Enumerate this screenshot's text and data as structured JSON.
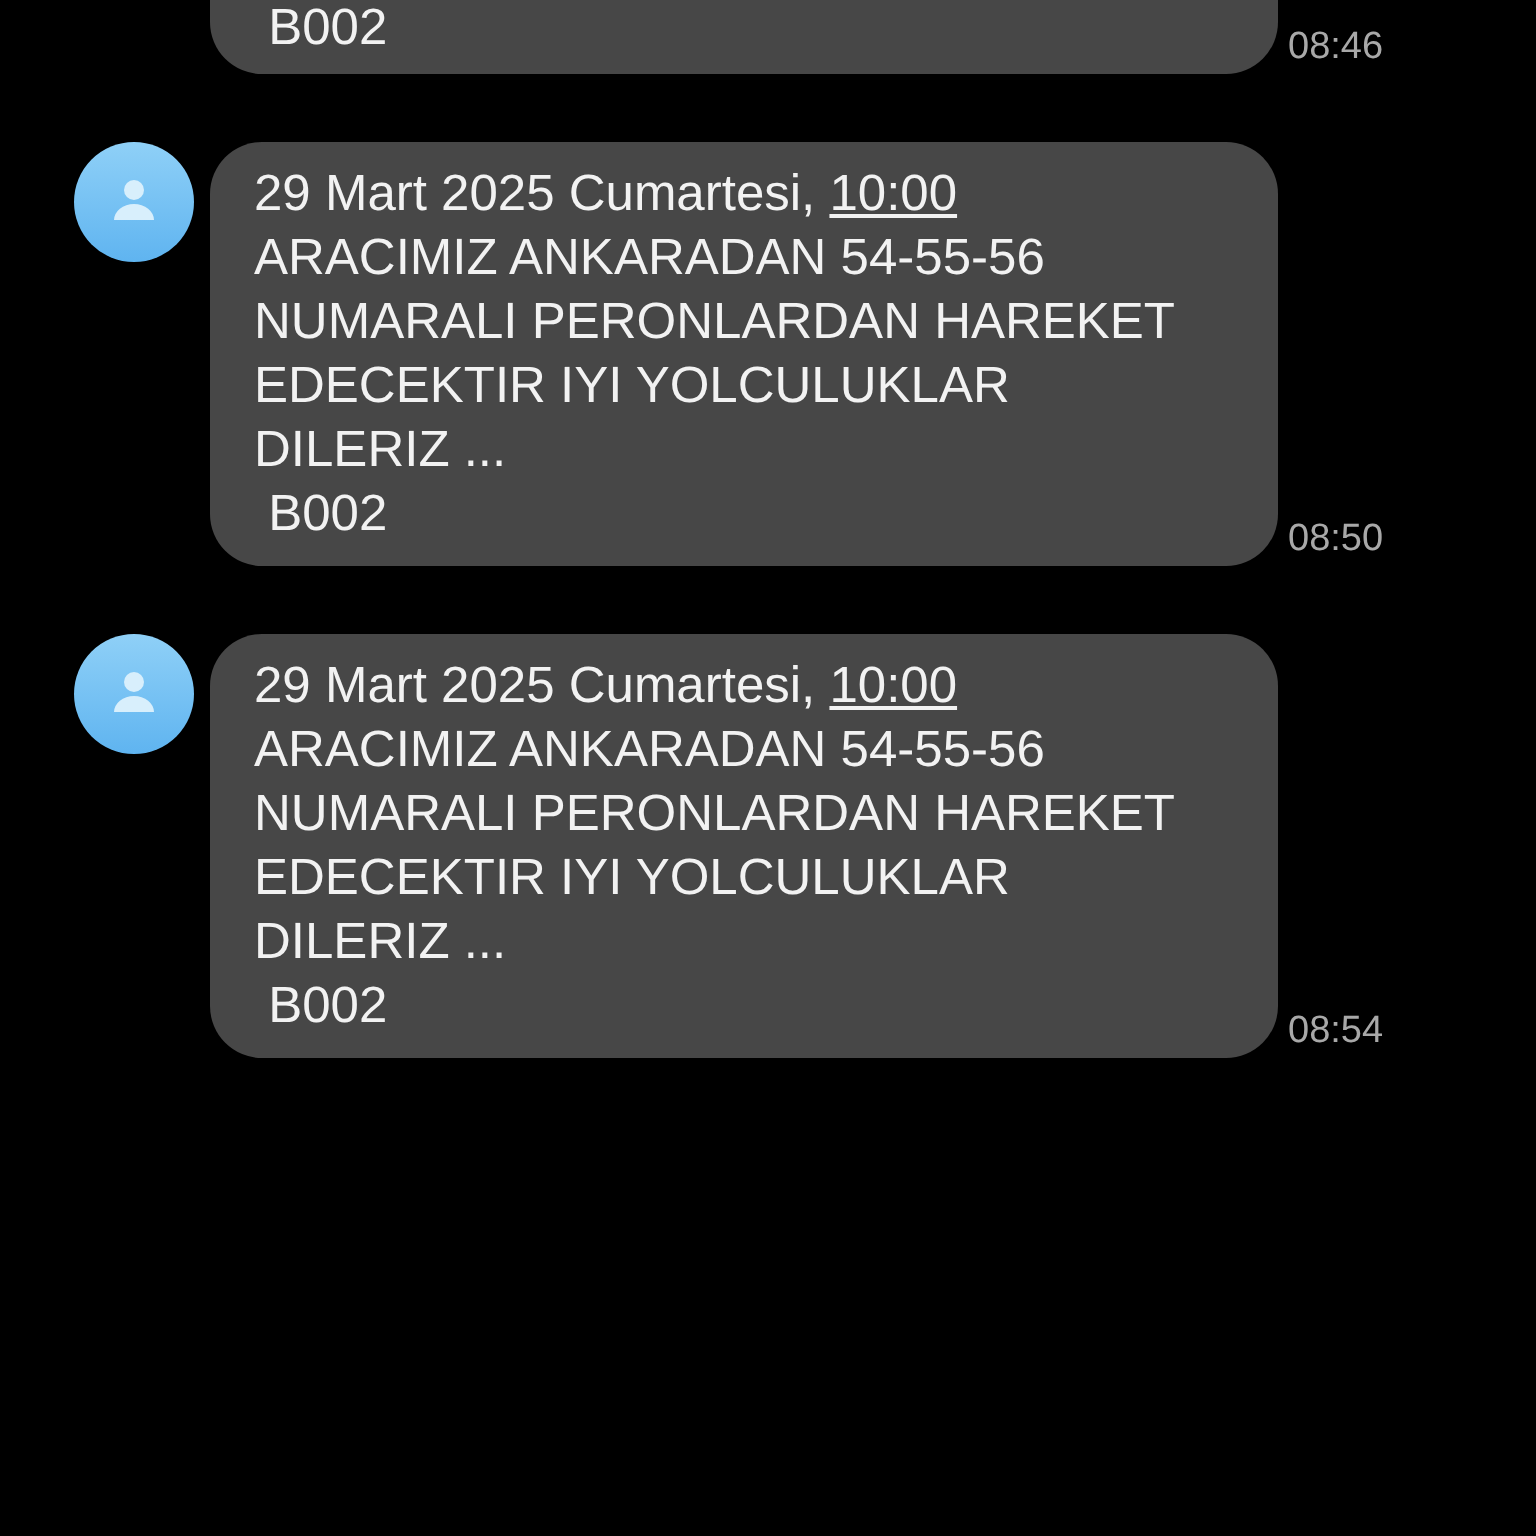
{
  "messages": [
    {
      "cut_top": true,
      "show_avatar": false,
      "signature": " B002",
      "time": "08:46"
    },
    {
      "cut_top": false,
      "show_avatar": true,
      "date": "29 Mart 2025 Cumartesi, ",
      "time_link": "10:00",
      "body": "ARACIMIZ ANKARADAN 54-55-56 NUMARALI PERONLARDAN HAREKET EDECEKTIR IYI YOLCULUKLAR DILERIZ ...",
      "signature": " B002",
      "time": "08:50"
    },
    {
      "cut_top": false,
      "show_avatar": true,
      "date": "29 Mart 2025 Cumartesi, ",
      "time_link": "10:00",
      "body": "ARACIMIZ ANKARADAN 54-55-56 NUMARALI PERONLARDAN HAREKET EDECEKTIR IYI YOLCULUKLAR DILERIZ ...",
      "signature": " B002",
      "time": "08:54"
    }
  ]
}
